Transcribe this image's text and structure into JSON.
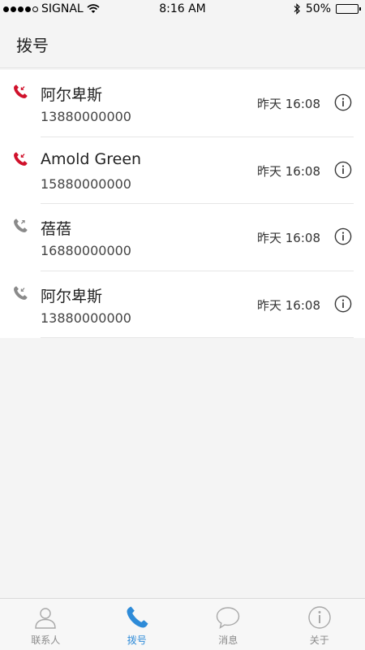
{
  "status_bar": {
    "carrier": "SIGNAL",
    "time": "8:16 AM",
    "battery": "50%",
    "battery_level": 0.5
  },
  "header": {
    "title": "拨号"
  },
  "calls": [
    {
      "name": "阿尔卑斯",
      "number": "13880000000",
      "time": "昨天 16:08",
      "type": "missed"
    },
    {
      "name": "Amold Green",
      "number": "15880000000",
      "time": "昨天 16:08",
      "type": "missed"
    },
    {
      "name": "蓓蓓",
      "number": "16880000000",
      "time": "昨天 16:08",
      "type": "outgoing"
    },
    {
      "name": "阿尔卑斯",
      "number": "13880000000",
      "time": "昨天 16:08",
      "type": "incoming"
    }
  ],
  "tabs": [
    {
      "label": "联系人",
      "icon": "person-icon",
      "active": false
    },
    {
      "label": "拨号",
      "icon": "phone-icon",
      "active": true
    },
    {
      "label": "消息",
      "icon": "chat-bubble-icon",
      "active": false
    },
    {
      "label": "关于",
      "icon": "info-icon",
      "active": false
    }
  ],
  "colors": {
    "missed": "#d0112b",
    "normal": "#8a8a8a",
    "active_tab": "#2e8bd8",
    "inactive_tab": "#a8a8a8"
  }
}
